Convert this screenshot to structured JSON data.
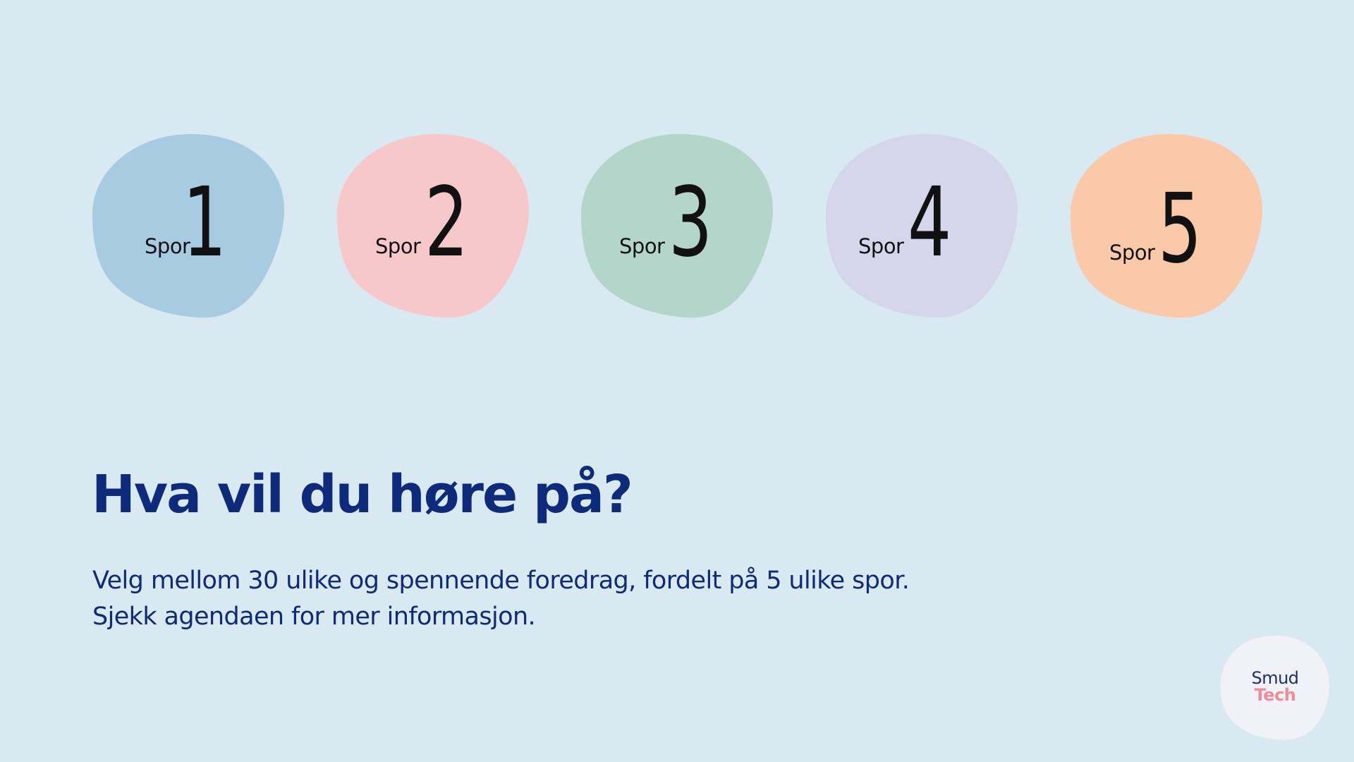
{
  "tracks": [
    {
      "word": "Spor",
      "number": "1",
      "color": "#a7cbe1"
    },
    {
      "word": "Spor",
      "number": "2",
      "color": "#f7c8c9"
    },
    {
      "word": "Spor",
      "number": "3",
      "color": "#b4d6ca"
    },
    {
      "word": "Spor",
      "number": "4",
      "color": "#d5d5eb"
    },
    {
      "word": "Spor",
      "number": "5",
      "color": "#f9c9a9"
    }
  ],
  "heading": "Hva vil du høre på?",
  "body": {
    "line1": "Velg mellom 30 ulike og spennende foredrag, fordelt på 5 ulike spor.",
    "line2": "Sjekk agendaen for mer informasjon."
  },
  "logo": {
    "line1": "Smud",
    "line2": "Tech",
    "background": "#f1f1f8",
    "color_top": "#1f2e6e",
    "color_bottom": "#ec8d97"
  },
  "background": "#d9e9f2",
  "text_color": "#0e2a7a"
}
